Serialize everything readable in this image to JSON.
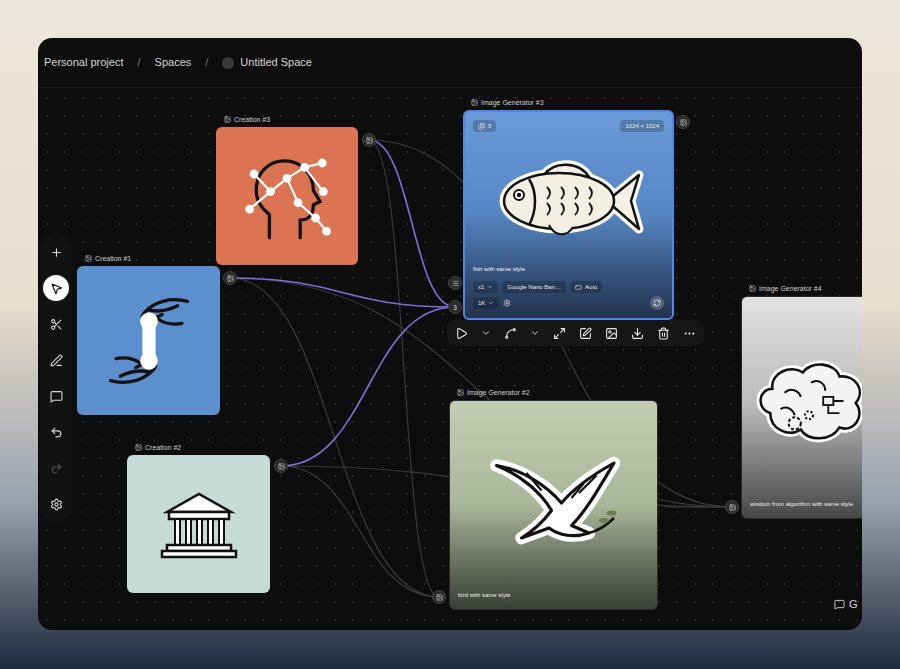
{
  "breadcrumb": [
    {
      "label": "Personal project"
    },
    {
      "label": "Spaces"
    },
    {
      "label": "Untitled Space"
    }
  ],
  "separator": "/",
  "creations": [
    {
      "label": "Creation #3",
      "color": "#dc7453"
    },
    {
      "label": "Creation #1",
      "color": "#5b8fcd"
    },
    {
      "label": "Creation #2",
      "color": "#c5dcd6"
    }
  ],
  "generators": [
    {
      "label": "Image Generator #3",
      "caption": "fish with same style",
      "selected": true
    },
    {
      "label": "Image Generator #2",
      "caption": "bird with same style",
      "selected": false
    },
    {
      "label": "Image Generator #4",
      "caption": "wisdom from algorithm with same style",
      "selected": false
    }
  ],
  "selected_generator": {
    "count": "5",
    "size": "1024 × 1024",
    "quantity": "x1",
    "model": "Google Nano Ban…",
    "aspect": "Auto",
    "resolution": "1K",
    "input_count": "3"
  },
  "tools": [
    {
      "kind": "add",
      "selected": false,
      "disabled": false
    },
    {
      "kind": "select",
      "selected": true,
      "disabled": false
    },
    {
      "kind": "cut",
      "selected": false,
      "disabled": false
    },
    {
      "kind": "draw",
      "selected": false,
      "disabled": false
    },
    {
      "kind": "comment",
      "selected": false,
      "disabled": false
    },
    {
      "kind": "undo",
      "selected": false,
      "disabled": false
    },
    {
      "kind": "redo",
      "selected": false,
      "disabled": true
    },
    {
      "kind": "settings",
      "selected": false,
      "disabled": false
    }
  ],
  "comments_button": {
    "label": "G"
  }
}
